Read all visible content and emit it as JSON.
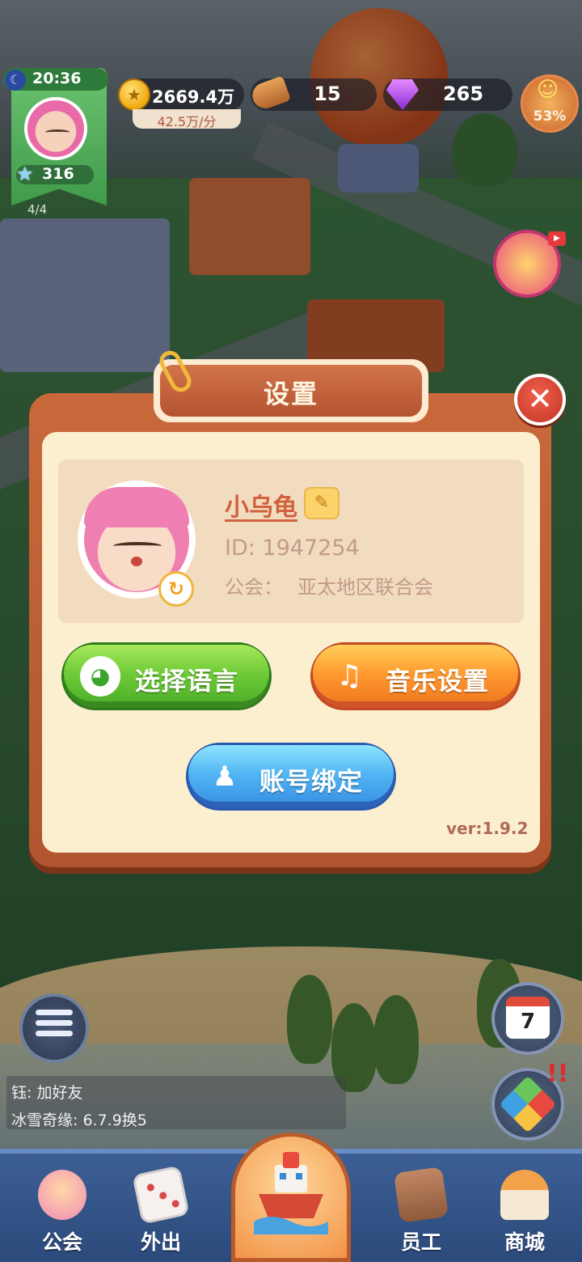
{
  "hud": {
    "time": "20:36",
    "level": "316",
    "slots": "4/4",
    "coins": "2669.4万",
    "coin_rate": "42.5万/分",
    "wood": "15",
    "gems": "265",
    "happiness": "53%"
  },
  "dialog": {
    "title": "设置",
    "nickname": "小乌龟",
    "user_id": "ID: 1947254",
    "guild_label": "公会：",
    "guild_name": "亚太地区联合会",
    "language_button": "选择语言",
    "music_button": "音乐设置",
    "account_button": "账号绑定",
    "version": "ver:1.9.2"
  },
  "chat": [
    "钰: 加好友",
    "冰雪奇缘: 6.7.9换5"
  ],
  "calendar_day": "7",
  "bottom_nav": [
    {
      "label": "公会"
    },
    {
      "label": "外出"
    },
    {
      "label": "员工"
    },
    {
      "label": "商城"
    }
  ],
  "colors": {
    "dialog_frame": "#b15530",
    "dialog_body": "#fbefcf",
    "nickname": "#d2613d",
    "green_button": "#6fcb38",
    "orange_button": "#ff9b30",
    "blue_button": "#52b6f3",
    "close_button": "#e04a38"
  },
  "icons": {
    "close": "close-icon",
    "edit": "pencil-icon",
    "refresh": "refresh-icon",
    "language": "globe-icon",
    "music": "music-note-icon",
    "account": "user-icon"
  }
}
